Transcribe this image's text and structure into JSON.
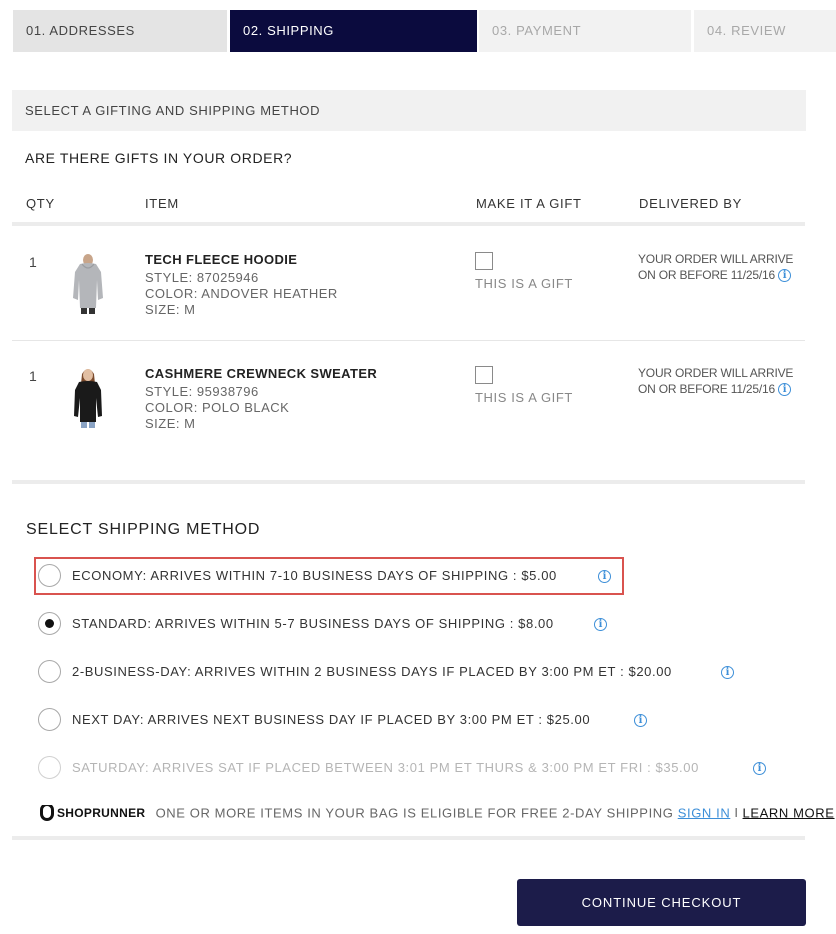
{
  "steps": [
    {
      "label": "01. ADDRESSES"
    },
    {
      "label": "02. SHIPPING"
    },
    {
      "label": "03. PAYMENT"
    },
    {
      "label": "04. REVIEW"
    }
  ],
  "section_title": "SELECT A GIFTING AND SHIPPING METHOD",
  "gifts_heading": "ARE THERE GIFTS IN YOUR ORDER?",
  "columns": {
    "qty": "QTY",
    "item": "ITEM",
    "gift": "MAKE IT A GIFT",
    "delivered": "DELIVERED BY"
  },
  "items": [
    {
      "qty": "1",
      "name": "TECH FLEECE HOODIE",
      "style": "STYLE: 87025946",
      "color": "COLOR: ANDOVER HEATHER",
      "size": "SIZE: M",
      "gift_label": "THIS IS A GIFT",
      "delivery_line1": "YOUR ORDER WILL ARRIVE",
      "delivery_line2": "ON OR BEFORE 11/25/16",
      "image": "gray hoodie"
    },
    {
      "qty": "1",
      "name": "CASHMERE CREWNECK SWEATER",
      "style": "STYLE: 95938796",
      "color": "COLOR: POLO BLACK",
      "size": "SIZE: M",
      "gift_label": "THIS IS A GIFT",
      "delivery_line1": "YOUR ORDER WILL ARRIVE",
      "delivery_line2": "ON OR BEFORE 11/25/16",
      "image": "black sweater"
    }
  ],
  "shipping_heading": "SELECT SHIPPING METHOD",
  "shipping_options": [
    {
      "label": "ECONOMY: ARRIVES WITHIN 7-10 BUSINESS DAYS OF SHIPPING : $5.00",
      "selected": false,
      "disabled": false
    },
    {
      "label": "STANDARD: ARRIVES WITHIN 5-7 BUSINESS DAYS OF SHIPPING : $8.00",
      "selected": true,
      "disabled": false
    },
    {
      "label": "2-BUSINESS-DAY: ARRIVES WITHIN 2 BUSINESS DAYS IF PLACED BY 3:00 PM ET : $20.00",
      "selected": false,
      "disabled": false
    },
    {
      "label": "NEXT DAY: ARRIVES NEXT BUSINESS DAY IF PLACED BY 3:00 PM ET : $25.00",
      "selected": false,
      "disabled": false
    },
    {
      "label": "SATURDAY: ARRIVES SAT IF PLACED BETWEEN 3:01 PM ET THURS & 3:00 PM ET FRI : $35.00",
      "selected": false,
      "disabled": true
    }
  ],
  "shoprunner": {
    "logo": "SHOPRUNNER",
    "message": "ONE OR MORE ITEMS IN YOUR BAG IS ELIGIBLE FOR FREE 2-DAY SHIPPING",
    "sign_in": "SIGN IN",
    "separator": "I",
    "learn_more": "LEARN MORE"
  },
  "continue_label": "CONTINUE CHECKOUT",
  "colors": {
    "active_step": "#0b0b3e",
    "button": "#1c1c4a",
    "highlight": "#d9534f",
    "link": "#3d8fd8"
  }
}
